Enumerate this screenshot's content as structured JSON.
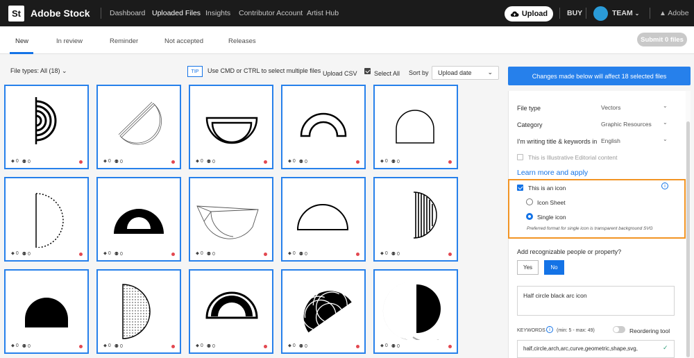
{
  "topbar": {
    "logo": "St",
    "brand": "Adobe Stock",
    "nav": [
      "Dashboard",
      "Uploaded Files",
      "Insights",
      "Contributor Account",
      "Artist Hub"
    ],
    "upload_label": "Upload",
    "buy_label": "BUY",
    "team_label": "TEAM",
    "adobe_label": "Adobe"
  },
  "tabs": [
    "New",
    "In review",
    "Reminder",
    "Not accepted",
    "Releases"
  ],
  "submit_label": "Submit 0 files",
  "filter": {
    "file_types": "File types: All (18)",
    "tip": "TIP",
    "tip_text": "Use CMD or CTRL to select multiple files",
    "upload_csv": "Upload CSV",
    "select_all": "Select All",
    "sort_by": "Sort by",
    "sort_value": "Upload date"
  },
  "tile_meta": {
    "tags": "0",
    "people": "0"
  },
  "tiles": [
    {
      "icon": "concentric-arcs-icon"
    },
    {
      "icon": "sketch-half-circle-icon"
    },
    {
      "icon": "outlined-bowl-icon"
    },
    {
      "icon": "outlined-arch-icon"
    },
    {
      "icon": "half-circle-outline-icon"
    },
    {
      "icon": "dotted-half-circle-icon"
    },
    {
      "icon": "bold-half-ring-icon"
    },
    {
      "icon": "wireframe-bowl-icon"
    },
    {
      "icon": "half-circle-line-icon"
    },
    {
      "icon": "striped-half-circle-icon"
    },
    {
      "icon": "filled-half-circle-icon"
    },
    {
      "icon": "dotted-fill-half-circle-icon"
    },
    {
      "icon": "double-half-ring-icon"
    },
    {
      "icon": "patterned-half-circle-icon"
    },
    {
      "icon": "crescent-half-circle-icon"
    }
  ],
  "panel": {
    "banner": "Changes made below will affect 18 selected files",
    "file_type_label": "File type",
    "file_type_value": "Vectors",
    "category_label": "Category",
    "category_value": "Graphic Resources",
    "language_label": "I'm writing title & keywords in",
    "language_value": "English",
    "editorial_label": "This is Illustrative Editorial content",
    "learn_more": "Learn more and apply",
    "icon_label": "This is an icon",
    "icon_sheet": "Icon Sheet",
    "single_icon": "Single icon",
    "icon_hint": "Preferred format for single icon is transparent background SVG",
    "people_question": "Add recognizable people or property?",
    "yes": "Yes",
    "no": "No",
    "title_value": "Half circle black arc icon",
    "keywords_label": "KEYWORDS",
    "keywords_range": "(min: 5 - max: 49)",
    "reordering": "Reordering tool",
    "keywords_value": "half,circle,arch,arc,curve,geometric,shape,svg,"
  },
  "colors": {
    "accent": "#1473e6",
    "highlight": "#f29423",
    "dot": "#e34850"
  }
}
